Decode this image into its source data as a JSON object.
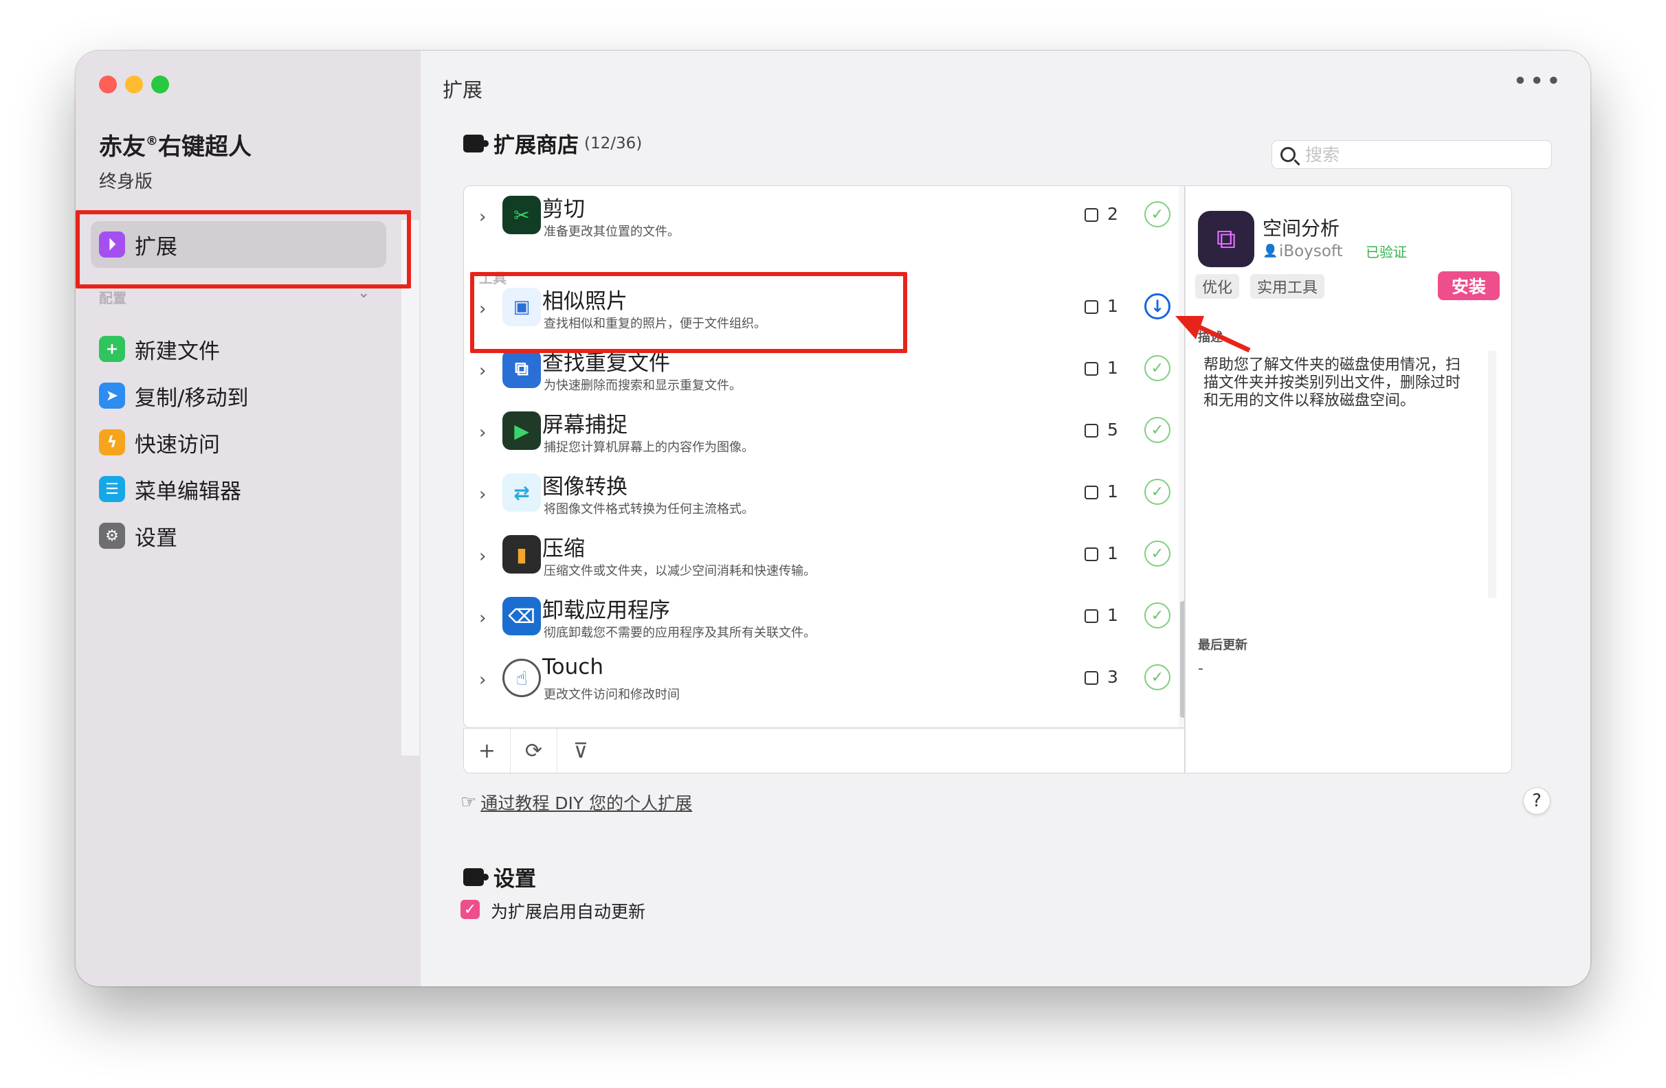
{
  "sidebar": {
    "app_title": "赤友",
    "app_title_mark": "®",
    "app_title_rest": "右键超人",
    "edition": "终身版",
    "group_label": "配置",
    "items": [
      {
        "label": "扩展",
        "icon": "extension-icon",
        "color": "#a44ff0"
      },
      {
        "label": "新建文件",
        "icon": "new-file-icon",
        "color": "#2fc45e"
      },
      {
        "label": "复制/移动到",
        "icon": "send-icon",
        "color": "#2d8cf0"
      },
      {
        "label": "快速访问",
        "icon": "bolt-icon",
        "color": "#f7a41d"
      },
      {
        "label": "菜单编辑器",
        "icon": "list-icon",
        "color": "#16a7e8"
      },
      {
        "label": "设置",
        "icon": "gear-icon",
        "color": "#6d6d72"
      }
    ]
  },
  "main": {
    "page_title": "扩展",
    "store": {
      "title": "扩展商店",
      "count": "(12/36)",
      "search_placeholder": "搜索",
      "category_label": "工具",
      "rows": [
        {
          "title": "剪切",
          "desc": "准备更改其位置的文件。",
          "count": "2",
          "status": "installed",
          "icon": "scissors-icon",
          "color": "#123d25"
        },
        {
          "title": "相似照片",
          "desc": "查找相似和重复的照片，便于文件组织。",
          "count": "1",
          "status": "download",
          "icon": "photos-icon",
          "color": "#3a7bd5"
        },
        {
          "title": "查找重复文件",
          "desc": "为快速删除而搜索和显示重复文件。",
          "count": "1",
          "status": "installed",
          "icon": "duplicate-files-icon",
          "color": "#2a6fd6"
        },
        {
          "title": "屏幕捕捉",
          "desc": "捕捉您计算机屏幕上的内容作为图像。",
          "count": "5",
          "status": "installed",
          "icon": "screen-capture-icon",
          "color": "#1f3a26"
        },
        {
          "title": "图像转换",
          "desc": "将图像文件格式转换为任何主流格式。",
          "count": "1",
          "status": "installed",
          "icon": "image-convert-icon",
          "color": "#2aa7e0"
        },
        {
          "title": "压缩",
          "desc": "压缩文件或文件夹，以减少空间消耗和快速传输。",
          "count": "1",
          "status": "installed",
          "icon": "archive-icon",
          "color": "#2b2b2b"
        },
        {
          "title": "卸载应用程序",
          "desc": "彻底卸载您不需要的应用程序及其所有关联文件。",
          "count": "1",
          "status": "installed",
          "icon": "uninstall-icon",
          "color": "#1b6ed0"
        },
        {
          "title": "Touch",
          "desc": "更改文件访问和修改时间",
          "count": "3",
          "status": "installed",
          "icon": "fingerprint-icon",
          "color": "#ffffff"
        }
      ]
    },
    "detail": {
      "name": "空间分析",
      "vendor": "iBoysoft",
      "verified": "已验证",
      "tags": [
        "优化",
        "实用工具"
      ],
      "install_label": "安装",
      "desc_label": "描述",
      "description": "帮助您了解文件夹的磁盘使用情况，扫描文件夹并按类别列出文件，删除过时和无用的文件以释放磁盘空间。",
      "updated_label": "最后更新",
      "updated_value": "-"
    },
    "diy_link": "通过教程 DIY 您的个人扩展",
    "help_label": "?",
    "settings": {
      "title": "设置",
      "auto_update_label": "为扩展启用自动更新",
      "auto_update_checked": true
    }
  },
  "colors": {
    "accent_pink": "#ee4e8c",
    "highlight_red": "#e8231a",
    "download_blue": "#1565e0",
    "installed_green": "#7fcf7f"
  }
}
